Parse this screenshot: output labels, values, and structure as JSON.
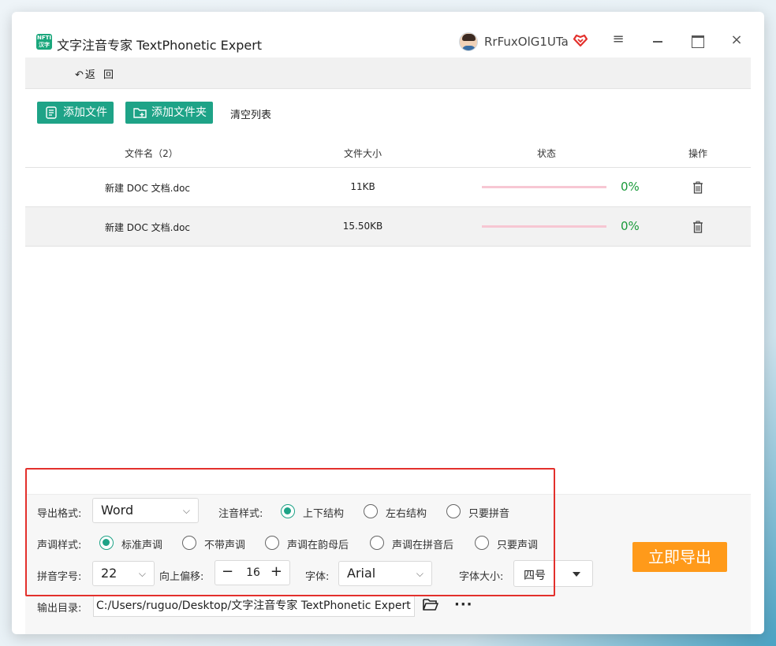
{
  "app": {
    "icon_text": "NFTI 汉字",
    "title": "文字注音专家 TextPhonetic Expert",
    "username": "RrFuxOlG1UTa"
  },
  "nav": {
    "back_label": "返 回",
    "back_icon": "back-arrow-icon"
  },
  "toolbar": {
    "add_file": "添加文件",
    "add_folder": "添加文件夹",
    "clear_list": "清空列表"
  },
  "table": {
    "headers": {
      "name": "文件名（2）",
      "size": "文件大小",
      "status": "状态",
      "action": "操作"
    },
    "rows": [
      {
        "name": "新建 DOC 文档.doc",
        "size": "11KB",
        "progress": 0,
        "percent": "0%"
      },
      {
        "name": "新建 DOC 文档.doc",
        "size": "15.50KB",
        "progress": 0,
        "percent": "0%"
      }
    ]
  },
  "options": {
    "export_format_label": "导出格式:",
    "export_format_value": "Word",
    "annotation_style_label": "注音样式:",
    "annotation_styles": [
      "上下结构",
      "左右结构",
      "只要拼音"
    ],
    "annotation_selected": 0,
    "tone_style_label": "声调样式:",
    "tone_styles": [
      "标准声调",
      "不带声调",
      "声调在韵母后",
      "声调在拼音后",
      "只要声调"
    ],
    "tone_selected": 0,
    "pinyin_size_label": "拼音字号:",
    "pinyin_size_value": "22",
    "offset_label": "向上偏移:",
    "offset_value": "16",
    "font_label": "字体:",
    "font_value": "Arial",
    "font_size_label": "字体大小:",
    "font_size_value": "四号",
    "output_dir_label": "输出目录:",
    "output_dir_value": "C:/Users/ruguo/Desktop/文字注音专家 TextPhonetic Expert"
  },
  "export_button": "立即导出",
  "colors": {
    "accent": "#1ea387",
    "export": "#ff9a1a",
    "percent": "#1a9a3a",
    "highlight": "#e3302c"
  }
}
